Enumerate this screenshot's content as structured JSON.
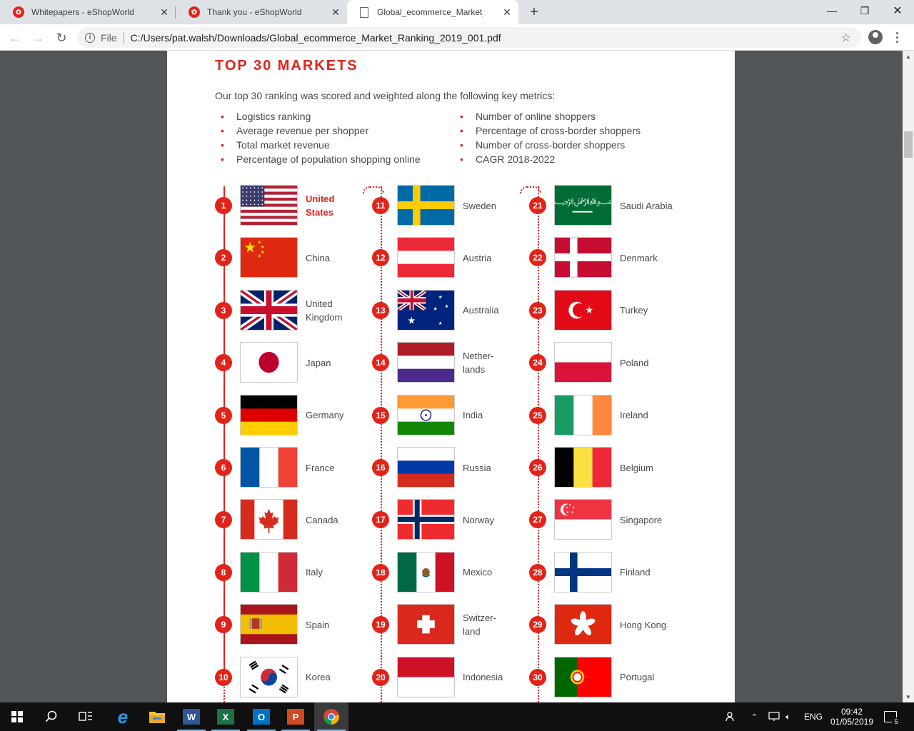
{
  "browser": {
    "tabs": [
      {
        "title": "Whitepapers - eShopWorld",
        "icon": "eshopworld-favicon"
      },
      {
        "title": "Thank you - eShopWorld",
        "icon": "eshopworld-favicon"
      },
      {
        "title": "Global_ecommerce_Market_Rank",
        "icon": "document-icon",
        "active": true
      }
    ],
    "new_tab": "+",
    "address": {
      "scheme_label": "File",
      "url": "C:/Users/pat.walsh/Downloads/Global_ecommerce_Market_Ranking_2019_001.pdf"
    }
  },
  "doc": {
    "title": "TOP 30 MARKETS",
    "intro": "Our top 30 ranking was scored and weighted along the following key metrics:",
    "metrics_left": [
      "Logistics ranking",
      "Average revenue per shopper",
      "Total market revenue",
      "Percentage of population shopping online"
    ],
    "metrics_right": [
      "Number of online shoppers",
      "Percentage of cross-border shoppers",
      "Number of cross-border shoppers",
      "CAGR 2018-2022"
    ],
    "accent_color": "#e2231a",
    "markets": [
      {
        "rank": "1",
        "name": "United\nStates",
        "flag": "us",
        "highlight": true
      },
      {
        "rank": "2",
        "name": "China",
        "flag": "cn"
      },
      {
        "rank": "3",
        "name": "United\nKingdom",
        "flag": "gb"
      },
      {
        "rank": "4",
        "name": "Japan",
        "flag": "jp"
      },
      {
        "rank": "5",
        "name": "Germany",
        "flag": "de"
      },
      {
        "rank": "6",
        "name": "France",
        "flag": "fr"
      },
      {
        "rank": "7",
        "name": "Canada",
        "flag": "ca"
      },
      {
        "rank": "8",
        "name": "Italy",
        "flag": "it"
      },
      {
        "rank": "9",
        "name": "Spain",
        "flag": "es"
      },
      {
        "rank": "10",
        "name": "Korea",
        "flag": "kr"
      },
      {
        "rank": "11",
        "name": "Sweden",
        "flag": "se"
      },
      {
        "rank": "12",
        "name": "Austria",
        "flag": "at"
      },
      {
        "rank": "13",
        "name": "Australia",
        "flag": "au"
      },
      {
        "rank": "14",
        "name": "Nether-\nlands",
        "flag": "nl"
      },
      {
        "rank": "15",
        "name": "India",
        "flag": "in"
      },
      {
        "rank": "16",
        "name": "Russia",
        "flag": "ru"
      },
      {
        "rank": "17",
        "name": "Norway",
        "flag": "no"
      },
      {
        "rank": "18",
        "name": "Mexico",
        "flag": "mx"
      },
      {
        "rank": "19",
        "name": "Switzer-\nland",
        "flag": "ch"
      },
      {
        "rank": "20",
        "name": "Indonesia",
        "flag": "id"
      },
      {
        "rank": "21",
        "name": "Saudi Arabia",
        "flag": "sa"
      },
      {
        "rank": "22",
        "name": "Denmark",
        "flag": "dk"
      },
      {
        "rank": "23",
        "name": "Turkey",
        "flag": "tr"
      },
      {
        "rank": "24",
        "name": "Poland",
        "flag": "pl"
      },
      {
        "rank": "25",
        "name": "Ireland",
        "flag": "ie"
      },
      {
        "rank": "26",
        "name": "Belgium",
        "flag": "be"
      },
      {
        "rank": "27",
        "name": "Singapore",
        "flag": "sg"
      },
      {
        "rank": "28",
        "name": "Finland",
        "flag": "fi"
      },
      {
        "rank": "29",
        "name": "Hong Kong",
        "flag": "hk"
      },
      {
        "rank": "30",
        "name": "Portugal",
        "flag": "pt"
      }
    ]
  },
  "taskbar": {
    "apps": [
      "start-icon",
      "search-icon",
      "task-view-icon",
      "edge-icon",
      "file-explorer-icon",
      "word-icon",
      "excel-icon",
      "outlook-icon",
      "powerpoint-icon",
      "chrome-icon"
    ],
    "language": "ENG",
    "time": "09:42",
    "date": "01/05/2019",
    "notifications": "5"
  }
}
